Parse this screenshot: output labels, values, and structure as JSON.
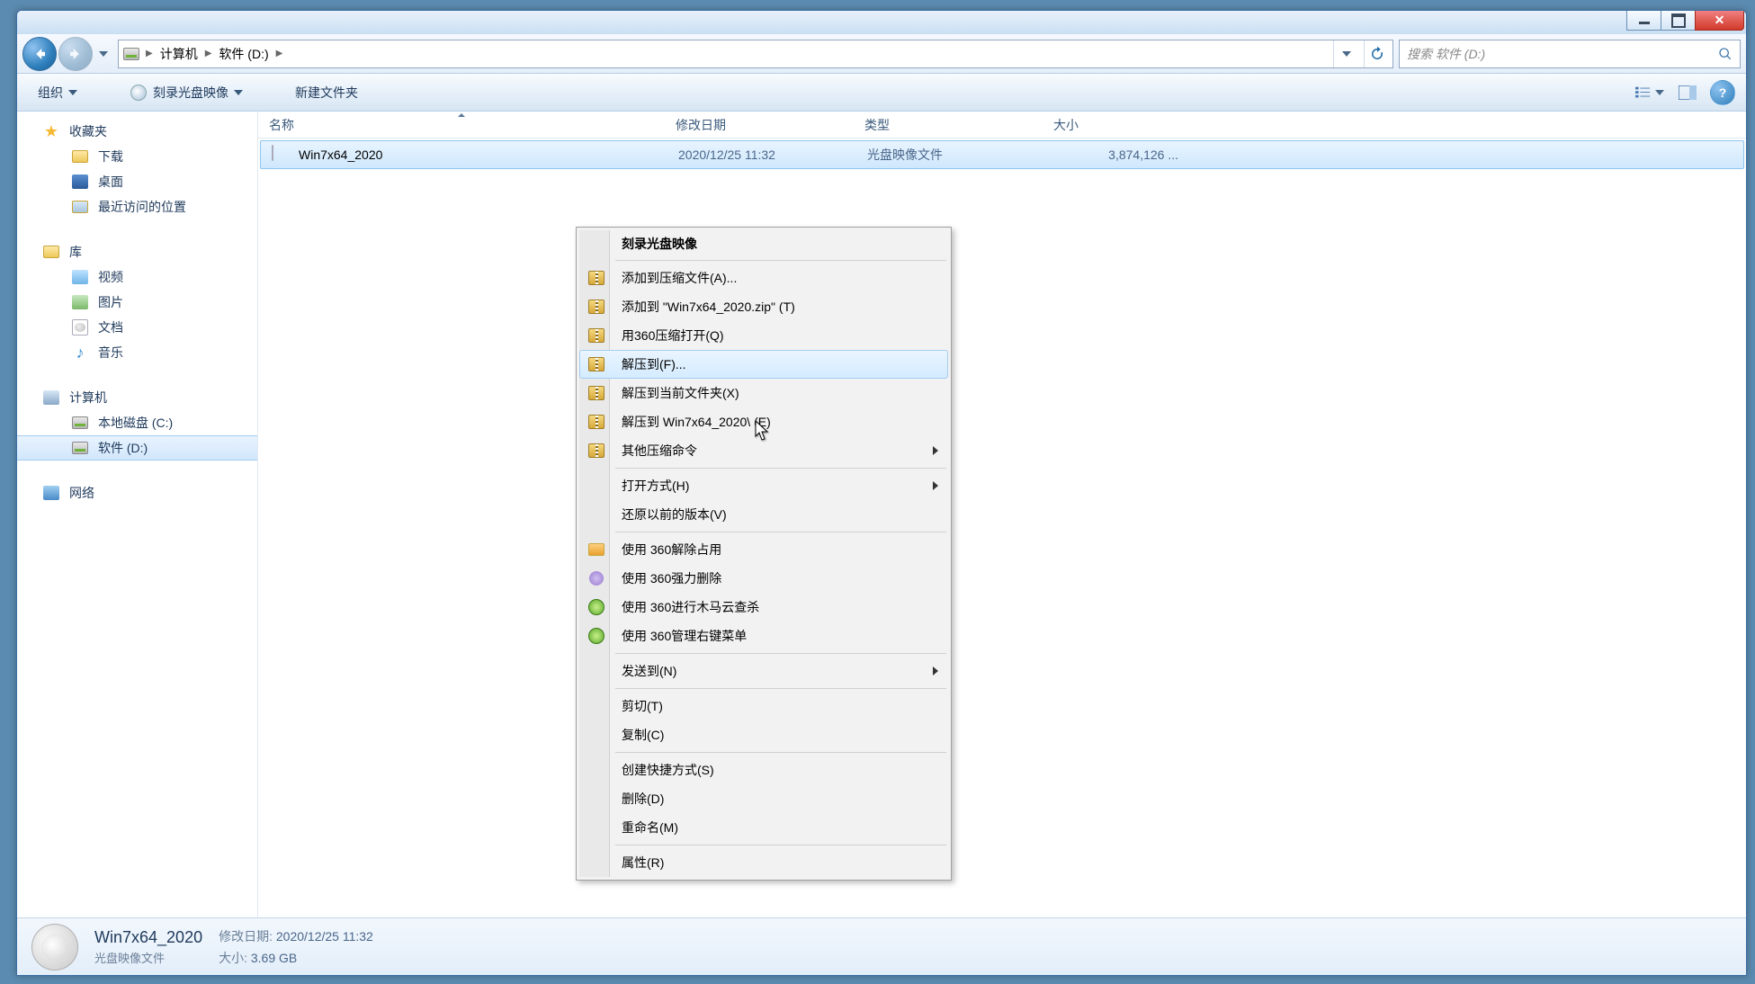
{
  "breadcrumb": {
    "computer": "计算机",
    "drive": "软件 (D:)"
  },
  "search": {
    "placeholder": "搜索 软件 (D:)"
  },
  "toolbar": {
    "organize": "组织",
    "burn": "刻录光盘映像",
    "newfolder": "新建文件夹"
  },
  "sidebar": {
    "favorites": {
      "head": "收藏夹",
      "downloads": "下载",
      "desktop": "桌面",
      "recent": "最近访问的位置"
    },
    "libraries": {
      "head": "库",
      "videos": "视频",
      "pictures": "图片",
      "documents": "文档",
      "music": "音乐"
    },
    "computer": {
      "head": "计算机",
      "cdrive": "本地磁盘 (C:)",
      "ddrive": "软件 (D:)"
    },
    "network": {
      "head": "网络"
    }
  },
  "columns": {
    "name": "名称",
    "date": "修改日期",
    "type": "类型",
    "size": "大小"
  },
  "file": {
    "name": "Win7x64_2020",
    "date": "2020/12/25 11:32",
    "type": "光盘映像文件",
    "size": "3,874,126 ..."
  },
  "context": {
    "burn": "刻录光盘映像",
    "addToArchive": "添加到压缩文件(A)...",
    "addToZip": "添加到 \"Win7x64_2020.zip\" (T)",
    "openWith360": "用360压缩打开(Q)",
    "extractTo": "解压到(F)...",
    "extractHere": "解压到当前文件夹(X)",
    "extractToFolder": "解压到 Win7x64_2020\\ (E)",
    "otherCompress": "其他压缩命令",
    "openWith": "打开方式(H)",
    "restorePrev": "还原以前的版本(V)",
    "unlock360": "使用 360解除占用",
    "forceDel360": "使用 360强力删除",
    "scan360": "使用 360进行木马云查杀",
    "menu360": "使用 360管理右键菜单",
    "sendTo": "发送到(N)",
    "cut": "剪切(T)",
    "copy": "复制(C)",
    "shortcut": "创建快捷方式(S)",
    "delete": "删除(D)",
    "rename": "重命名(M)",
    "properties": "属性(R)"
  },
  "details": {
    "title": "Win7x64_2020",
    "type": "光盘映像文件",
    "dateLabel": "修改日期:",
    "date": "2020/12/25 11:32",
    "sizeLabel": "大小:",
    "size": "3.69 GB"
  }
}
